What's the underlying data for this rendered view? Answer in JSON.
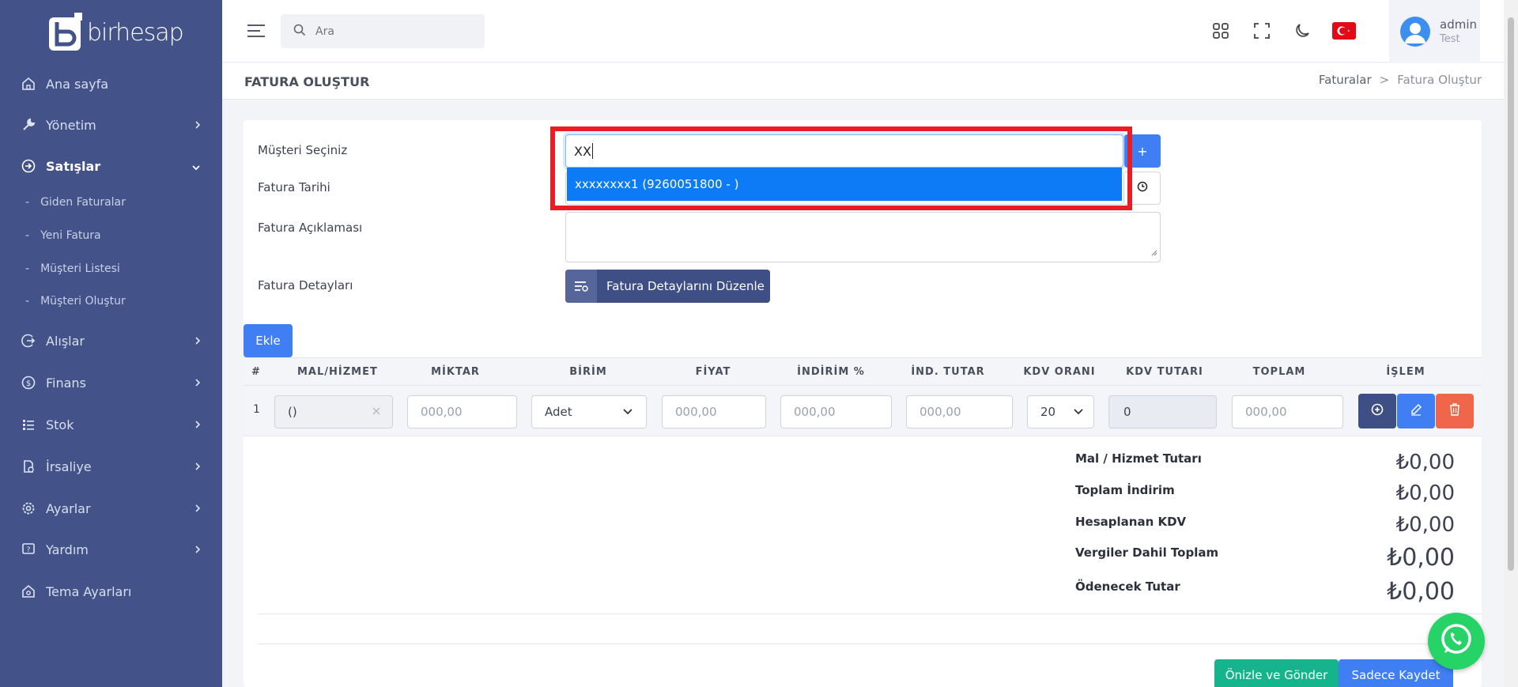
{
  "brand": {
    "name": "birhesap"
  },
  "sidebar": {
    "items": [
      {
        "label": "Ana sayfa",
        "icon": "home-icon"
      },
      {
        "label": "Yönetim",
        "icon": "wrench-icon"
      },
      {
        "label": "Satışlar",
        "icon": "sign-in-icon"
      },
      {
        "label": "Alışlar",
        "icon": "sign-out-icon"
      },
      {
        "label": "Finans",
        "icon": "dollar-icon"
      },
      {
        "label": "Stok",
        "icon": "list-icon"
      },
      {
        "label": "İrsaliye",
        "icon": "document-icon"
      },
      {
        "label": "Ayarlar",
        "icon": "gear-icon"
      },
      {
        "label": "Yardım",
        "icon": "help-icon"
      },
      {
        "label": "Tema Ayarları",
        "icon": "theme-icon"
      }
    ],
    "sub_items": [
      "Giden Faturalar",
      "Yeni Fatura",
      "Müşteri Listesi",
      "Müşteri Oluştur"
    ]
  },
  "topbar": {
    "search_placeholder": "Ara",
    "user_name": "admin",
    "user_role": "Test"
  },
  "page": {
    "title": "FATURA OLUŞTUR",
    "breadcrumb": [
      "Faturalar",
      ">",
      "Fatura Oluştur"
    ]
  },
  "form": {
    "customer_label": "Müşteri Seçiniz",
    "customer_value": "XX",
    "dropdown_option": "xxxxxxxx1 (9260051800 - )",
    "plus_label": "+",
    "date_label": "Fatura Tarihi",
    "desc_label": "Fatura Açıklaması",
    "details_label": "Fatura Detayları",
    "details_button": "Fatura Detaylarını Düzenle",
    "add_button": "Ekle"
  },
  "table": {
    "headers": [
      "#",
      "MAL/HİZMET",
      "MİKTAR",
      "BİRİM",
      "FİYAT",
      "İNDİRİM %",
      "İND. TUTAR",
      "KDV ORANI",
      "KDV TUTARI",
      "TOPLAM",
      "İŞLEM"
    ],
    "row": {
      "index": "1",
      "product": "()",
      "quantity_placeholder": "000,00",
      "unit": "Adet",
      "price_placeholder": "000,00",
      "discount_placeholder": "000,00",
      "discount_amount_placeholder": "000,00",
      "vat_rate": "20",
      "vat_amount": "0",
      "total_placeholder": "000,00"
    }
  },
  "totals": {
    "goods_label": "Mal / Hizmet Tutarı",
    "goods_value": "₺0,00",
    "discount_label": "Toplam İndirim",
    "discount_value": "₺0,00",
    "vat_label": "Hesaplanan KDV",
    "vat_value": "₺0,00",
    "incl_label": "Vergiler Dahil Toplam",
    "incl_value": "₺0,00",
    "payable_label": "Ödenecek Tutar",
    "payable_value": "₺0,00"
  },
  "actions": {
    "preview_send": "Önizle ve Gönder",
    "save_only": "Sadece Kaydet"
  },
  "colors": {
    "sidebar": "#435389",
    "primary": "#3f7ff3",
    "highlight": "#ec1c24",
    "success": "#15b48c",
    "danger": "#f0664a"
  }
}
